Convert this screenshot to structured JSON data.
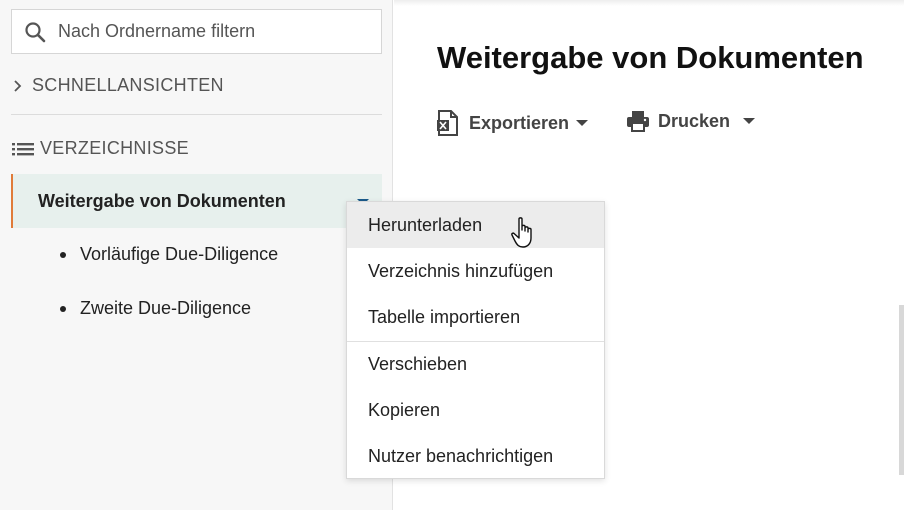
{
  "sidebar": {
    "search": {
      "placeholder": "Nach Ordnername filtern",
      "value": ""
    },
    "quick_views": {
      "label": "SCHNELLANSICHTEN",
      "icon": "chevron-right-icon"
    },
    "directories": {
      "label": "VERZEICHNISSE",
      "icon": "list-icon"
    },
    "tree": {
      "active": {
        "label": "Weitergabe von Dokumenten",
        "accent_color": "#e07b39",
        "caret_color": "#1a5a8a"
      },
      "children": [
        {
          "label": "Vorläufige Due-Diligence"
        },
        {
          "label": "Zweite Due-Diligence"
        }
      ]
    }
  },
  "main": {
    "title": "Weitergabe von Dokumenten",
    "toolbar": {
      "export": {
        "label": "Exportieren",
        "icon": "excel-file-icon"
      },
      "print": {
        "label": "Drucken",
        "icon": "printer-icon"
      }
    }
  },
  "context_menu": {
    "items": [
      {
        "label": "Herunterladen",
        "hover": true
      },
      {
        "label": "Verzeichnis hinzufügen"
      },
      {
        "label": "Tabelle importieren"
      },
      {
        "label": "Verschieben"
      },
      {
        "label": "Kopieren"
      },
      {
        "label": "Nutzer benachrichtigen"
      }
    ]
  }
}
